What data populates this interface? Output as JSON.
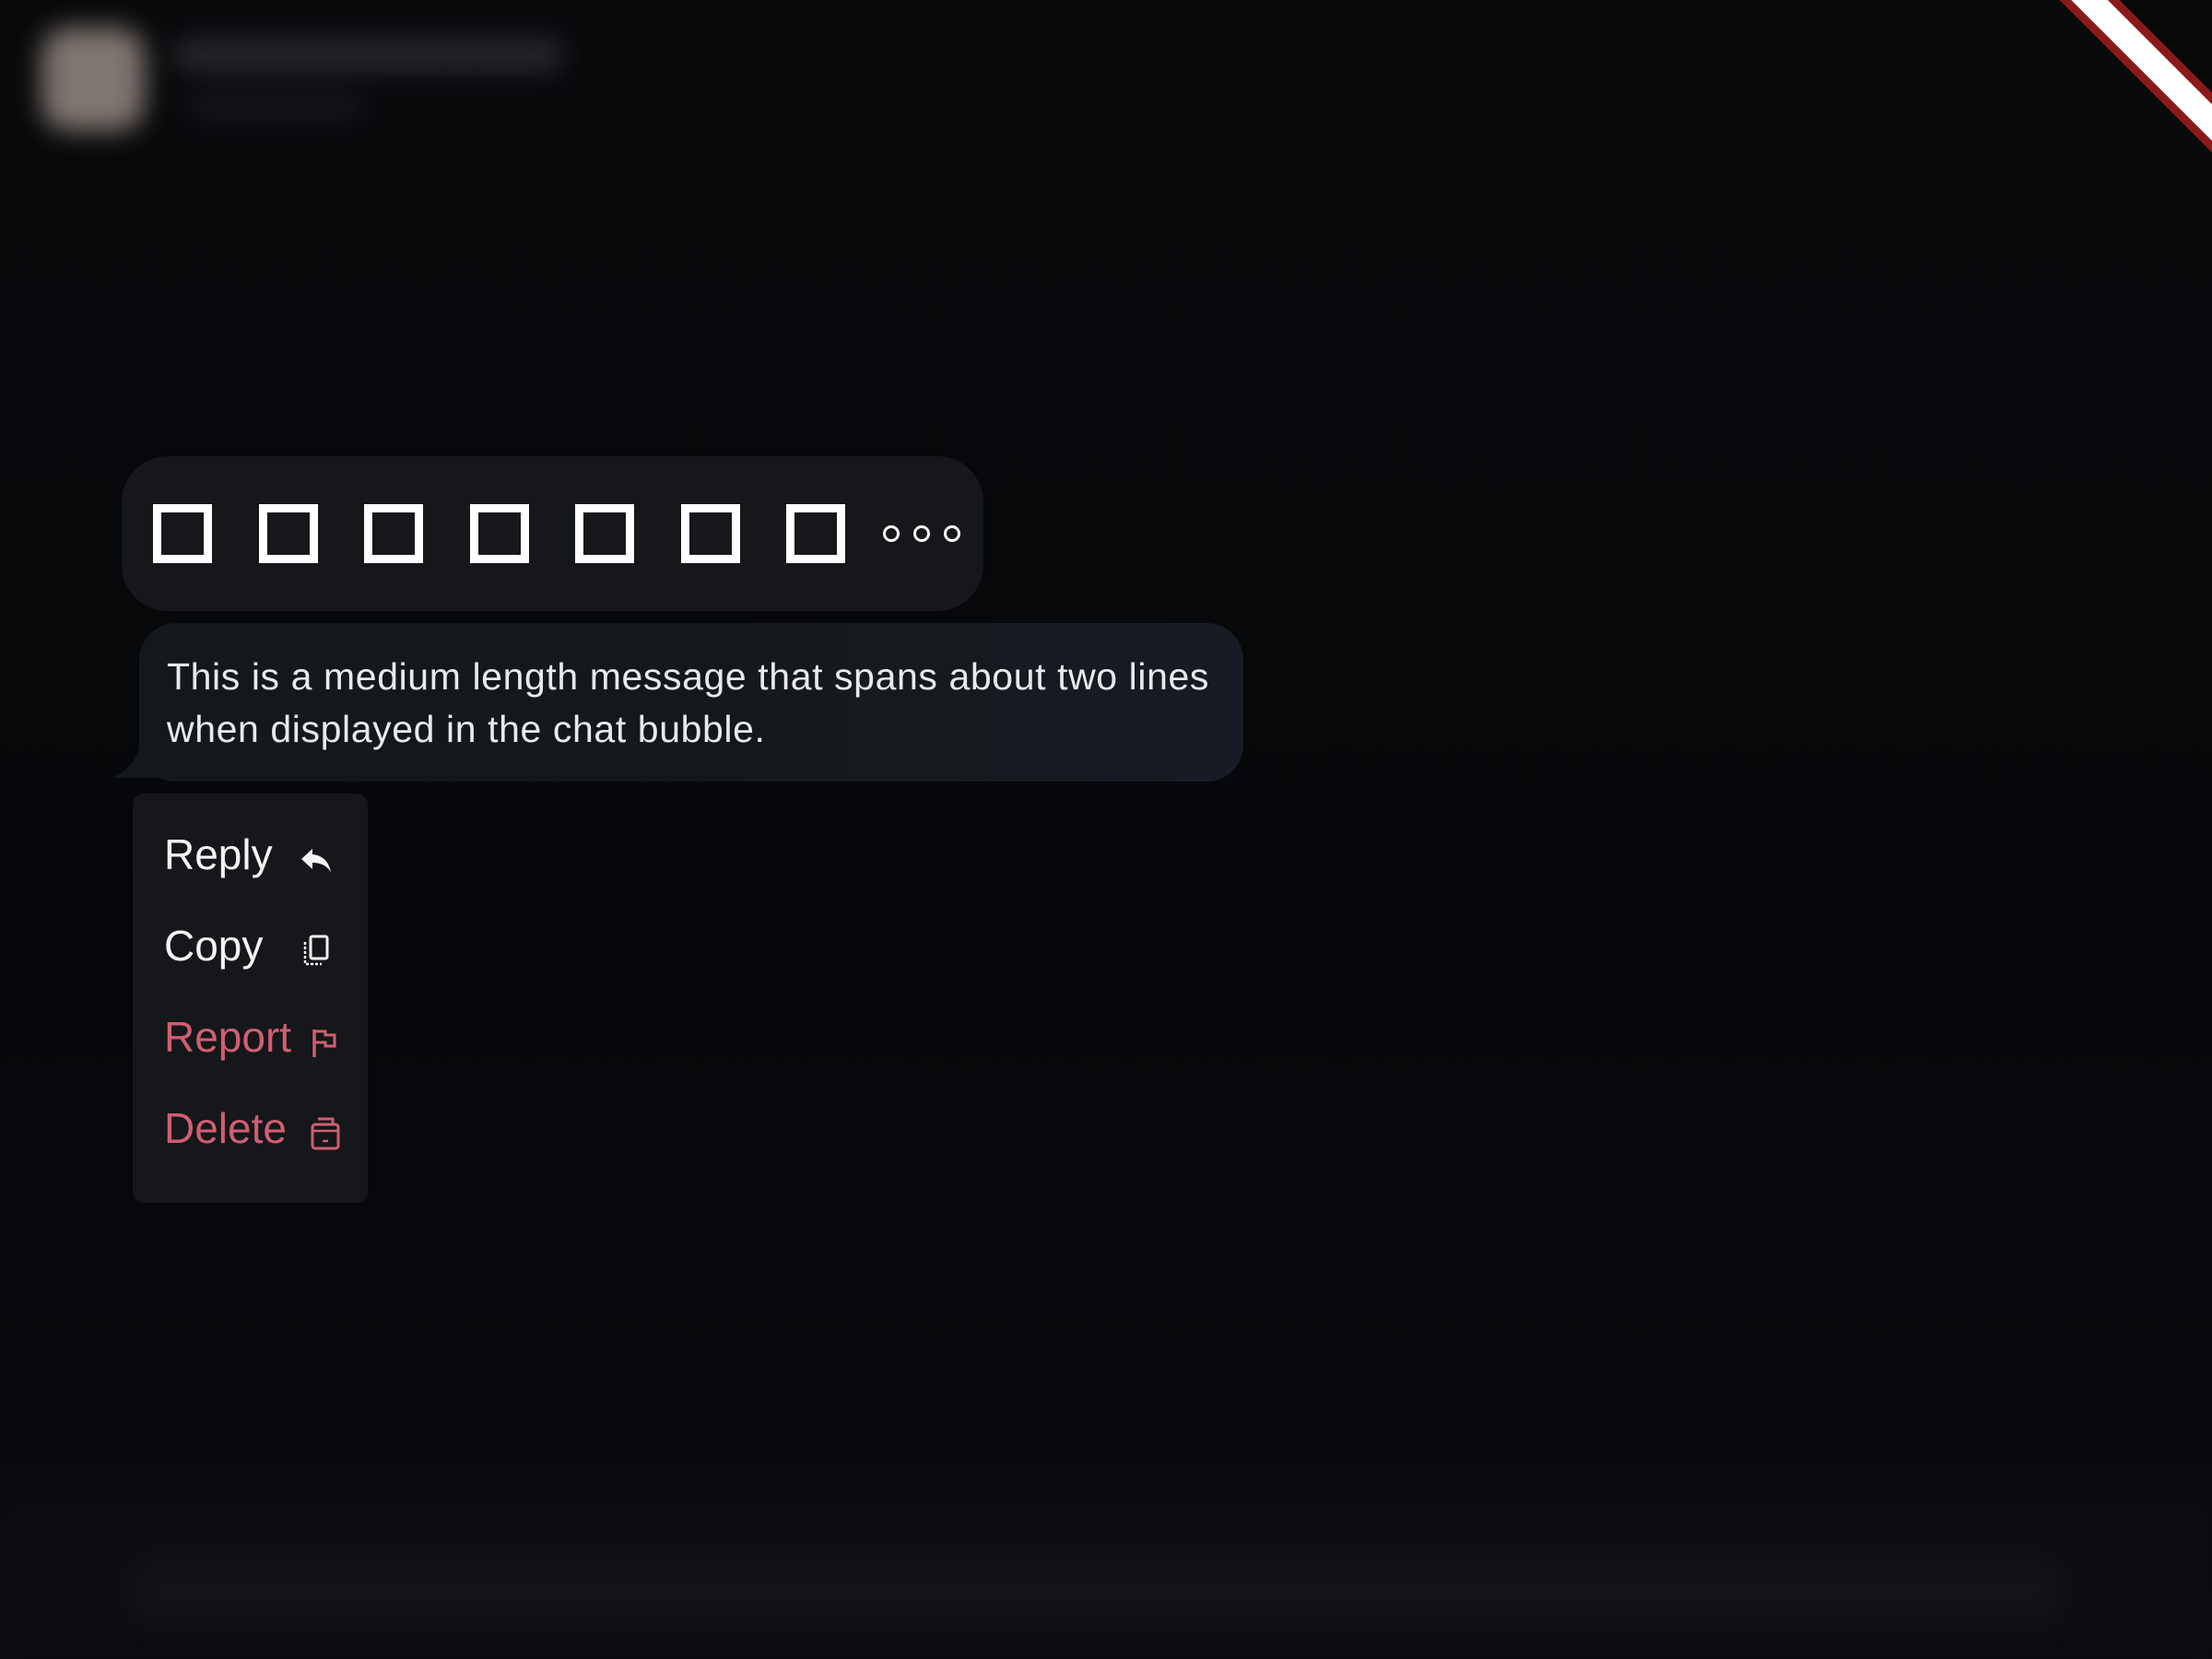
{
  "reactions": {
    "items": [
      {
        "icon": "emoji-placeholder-1"
      },
      {
        "icon": "emoji-placeholder-2"
      },
      {
        "icon": "emoji-placeholder-3"
      },
      {
        "icon": "emoji-placeholder-4"
      },
      {
        "icon": "emoji-placeholder-5"
      },
      {
        "icon": "emoji-placeholder-6"
      },
      {
        "icon": "emoji-placeholder-7"
      }
    ],
    "more_icon": "more-horizontal-icon"
  },
  "message": {
    "text": "This is a medium length message that spans about two lines when displayed in the chat bubble."
  },
  "context_menu": {
    "items": [
      {
        "label": "Reply",
        "icon": "reply-icon",
        "danger": false
      },
      {
        "label": "Copy",
        "icon": "copy-icon",
        "danger": false
      },
      {
        "label": "Report",
        "icon": "flag-icon",
        "danger": true
      },
      {
        "label": "Delete",
        "icon": "trash-icon",
        "danger": true
      }
    ]
  },
  "colors": {
    "background": "#07080a",
    "surface": "#15171a",
    "text": "#f3f4f6",
    "danger": "#cf5f73",
    "debug_banner": "#8b1a1a"
  }
}
